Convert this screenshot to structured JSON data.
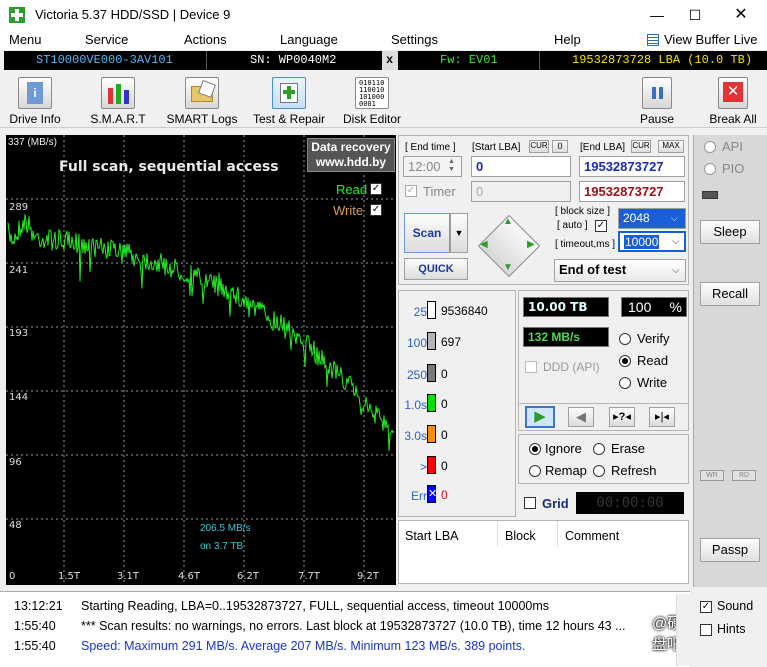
{
  "window": {
    "title": "Victoria 5.37 HDD/SSD | Device 9"
  },
  "menu": [
    "Menu",
    "Service",
    "Actions",
    "Language",
    "Settings",
    "Help"
  ],
  "menu_right": "View Buffer Live",
  "infobar": {
    "model": "ST10000VE000-3AV101",
    "serial": "SN: WP0040M2",
    "x": "x",
    "firmware": "Fw: EV01",
    "capacity": "19532873728 LBA (10.0 TB)"
  },
  "toolbar": {
    "buttons": [
      "Drive Info",
      "S.M.A.R.T",
      "SMART Logs",
      "Test & Repair",
      "Disk Editor"
    ],
    "pause": "Pause",
    "break_all": "Break All"
  },
  "graph": {
    "unit": "337 (MB/s)",
    "title": "Full scan, sequential access",
    "badge_line1": "Data recovery",
    "badge_line2": "www.hdd.by",
    "read_label": "Read",
    "write_label": "Write",
    "y_labels": [
      "289",
      "241",
      "193",
      "144",
      "96",
      "48",
      "0"
    ],
    "x_labels": [
      "1.5T",
      "3.1T",
      "4.6T",
      "6.2T",
      "7.7T",
      "9.2T"
    ],
    "avg_line1": "206.5 MB/s",
    "avg_line2": "on 3.7 TB"
  },
  "params": {
    "end_time_label": "[ End time ]",
    "start_lba_label": "[Start LBA]",
    "cur": "CUR",
    "zero": "0",
    "end_lba_label": "[End LBA]",
    "max": "MAX",
    "time_value": "12:00",
    "start_lba": "0",
    "end_lba": "19532873727",
    "timer_label": "Timer",
    "timer_value": "0",
    "end_lba_red": "19532873727",
    "block_size_label": "[ block size ]",
    "auto_label": "[ auto ]",
    "timeout_label": "[ timeout,ms ]",
    "block_size": "2048",
    "timeout": "10000",
    "scan": "Scan",
    "quick": "QUICK",
    "end_of_test": "End of test"
  },
  "legend": [
    {
      "name": "25",
      "count": "9536840",
      "color": "#ffffff"
    },
    {
      "name": "100",
      "count": "697",
      "color": "#b4b4b4"
    },
    {
      "name": "250",
      "count": "0",
      "color": "#787878"
    },
    {
      "name": "1.0s",
      "count": "0",
      "color": "#00e000"
    },
    {
      "name": "3.0s",
      "count": "0",
      "color": "#ff8c00"
    },
    {
      "name": ">",
      "count": "0",
      "color": "#ff0000"
    },
    {
      "name": "Err",
      "count": "0",
      "color": "#0000ff"
    }
  ],
  "status": {
    "processed": "10.00 TB",
    "percent": "100",
    "percent_sign": "%",
    "speed": "132 MB/s",
    "ddd": "DDD (API)",
    "verify": "Verify",
    "read": "Read",
    "write": "Write"
  },
  "action": {
    "ignore": "Ignore",
    "erase": "Erase",
    "remap": "Remap",
    "refresh": "Refresh",
    "grid": "Grid",
    "grid_timer": "00:00:00"
  },
  "table": {
    "headers": [
      "Start LBA",
      "Block",
      "Comment"
    ]
  },
  "side": {
    "api": "API",
    "pio": "PIO",
    "sleep": "Sleep",
    "recall": "Recall",
    "wr": "WR",
    "rd": "RD",
    "passp": "Passp",
    "sound": "Sound",
    "hints": "Hints"
  },
  "log": [
    {
      "time": "13:12:21",
      "msg": "Starting Reading, LBA=0..19532873727, FULL, sequential access, timeout 10000ms",
      "color": "#000000"
    },
    {
      "time": "1:55:40",
      "msg": "*** Scan results: no warnings, no errors. Last block at 19532873727 (10.0 TB), time 12 hours 43 ...",
      "color": "#000000"
    },
    {
      "time": "1:55:40",
      "msg": "Speed: Maximum 291 MB/s. Average 207 MB/s. Minimum 123 MB/s. 389 points.",
      "color": "#1a36c8"
    }
  ],
  "watermark": "@硬盘吧",
  "colors": {
    "graph_line": "#22ee22",
    "lcd_text": "#ffffff",
    "speed_lcd": "#4fd84f"
  }
}
